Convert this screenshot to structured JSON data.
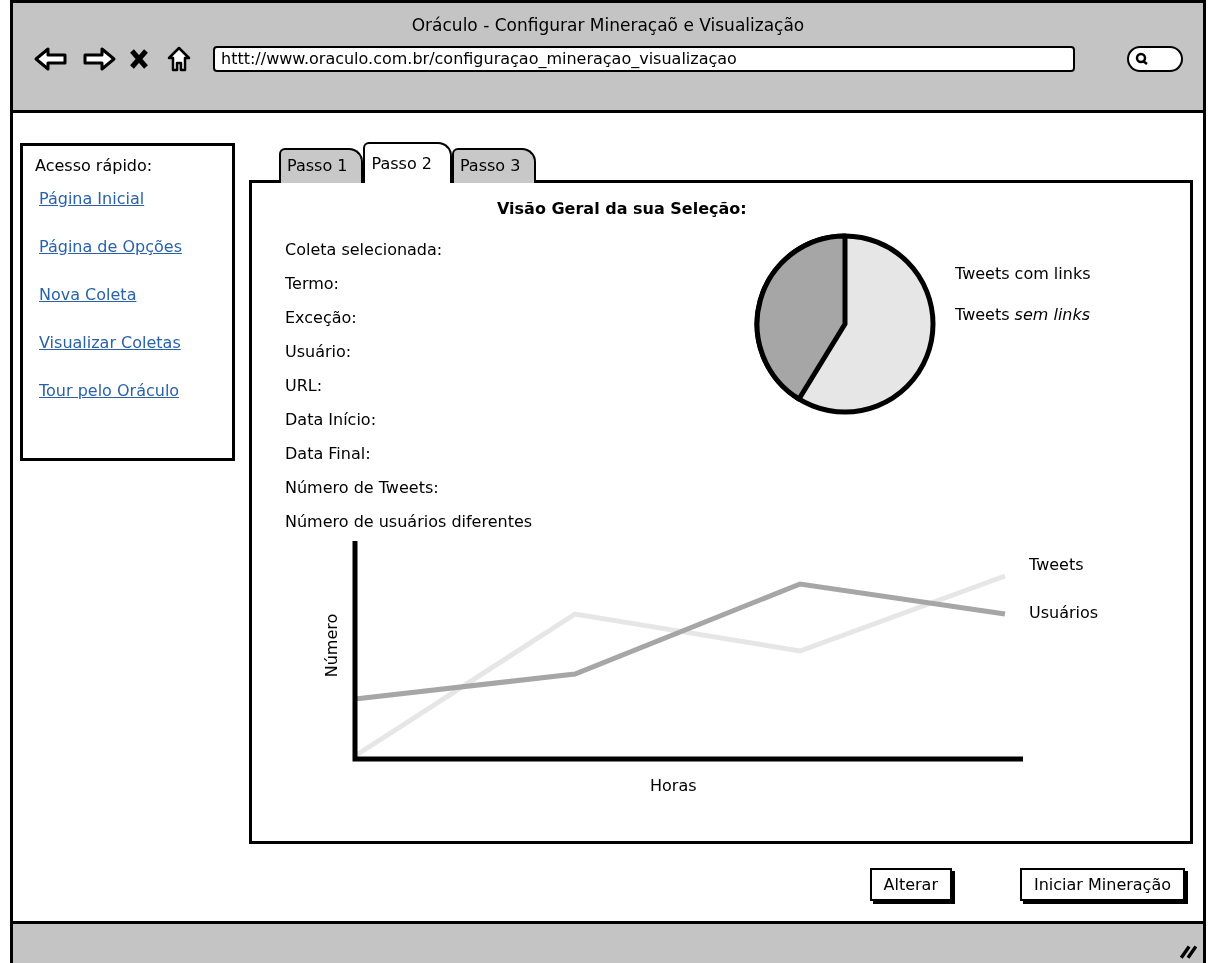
{
  "window": {
    "title": "Oráculo - Configurar Mineraçaõ e Visualização",
    "url": "httt://www.oraculo.com.br/configuraçao_mineraçao_visualizaçao"
  },
  "sidebar": {
    "title": "Acesso rápido:",
    "links": [
      "Página Inicial",
      "Página de Opções",
      "Nova Coleta",
      "Visualizar Coletas",
      "Tour pelo Oráculo"
    ]
  },
  "tabs": [
    {
      "label": "Passo 1",
      "selected": false
    },
    {
      "label": "Passo 2",
      "selected": true
    },
    {
      "label": "Passo 3",
      "selected": false
    }
  ],
  "panel": {
    "heading": "Visão Geral da sua Seleção:",
    "fields": [
      "Coleta selecionada:",
      "Termo:",
      "Exceção:",
      "Usuário:",
      "URL:",
      "Data Início:",
      "Data Final:",
      "Número de Tweets:",
      "Número de usuários diferentes"
    ],
    "pie_legend": [
      "Tweets com links",
      "Tweets *sem links*"
    ],
    "line_chart": {
      "ylabel": "Número",
      "xlabel": "Horas",
      "series": [
        {
          "name": "Tweets"
        },
        {
          "name": "Usuários"
        }
      ]
    }
  },
  "buttons": [
    "Alterar",
    "Iniciar Mineração"
  ]
}
